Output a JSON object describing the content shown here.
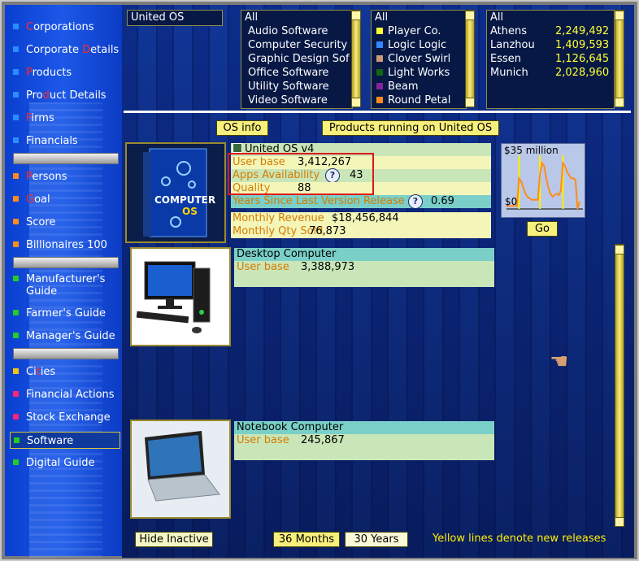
{
  "sidebar": {
    "items": [
      {
        "first": "C",
        "rest": "orporations",
        "color": "#2a8cff"
      },
      {
        "first": "Corporate ",
        "red": "D",
        "rest": "etails",
        "color": "#2a8cff"
      },
      {
        "first": "P",
        "rest": "roducts",
        "color": "#2a8cff"
      },
      {
        "first": "Pro",
        "red": "d",
        "rest": "uct Details",
        "color": "#2a8cff"
      },
      {
        "first": "F",
        "rest": "irms",
        "color": "#2a8cff"
      },
      {
        "first": "Financials",
        "rest": "",
        "color": "#2a8cff"
      },
      {
        "first": "P",
        "rest": "ersons",
        "color": "#ff8c1a"
      },
      {
        "first": "G",
        "rest": "oal",
        "color": "#ff8c1a"
      },
      {
        "first": "Score",
        "rest": "",
        "color": "#ff8c1a"
      },
      {
        "first": "Billionaires 100",
        "rest": "",
        "color": "#ff8c1a"
      },
      {
        "first": "Manufacturer's Guide",
        "rest": "",
        "color": "#22cc22"
      },
      {
        "first": "Farmer's Guide",
        "rest": "",
        "color": "#22cc22"
      },
      {
        "first": "Manager's Guide",
        "rest": "",
        "color": "#22cc22"
      },
      {
        "first": "Ci",
        "red": "t",
        "rest": "ies",
        "color": "#f2c40f"
      },
      {
        "first": "Financial Actions",
        "rest": "",
        "color": "#ff2277"
      },
      {
        "first": "Stock Exchange",
        "rest": "",
        "color": "#ff2277"
      },
      {
        "first": "Software",
        "rest": "",
        "color": "#22cc22"
      },
      {
        "first": "Digital Guide",
        "rest": "",
        "color": "#22cc22"
      }
    ]
  },
  "filters": {
    "os_selected": "United OS",
    "categories": [
      "All",
      "Audio Software",
      "Computer Security",
      "Graphic Design Sof",
      "Office Software",
      "Utility Software",
      "Video Software"
    ],
    "companies": [
      {
        "name": "All",
        "color": ""
      },
      {
        "name": "Player Co.",
        "color": "#ffff33"
      },
      {
        "name": "Logic Logic",
        "color": "#3388ff"
      },
      {
        "name": "Clover Swirl",
        "color": "#c89a78"
      },
      {
        "name": "Light Works",
        "color": "#116611"
      },
      {
        "name": "Beam",
        "color": "#882299"
      },
      {
        "name": "Round Petal",
        "color": "#ff8c1a"
      }
    ],
    "cities": [
      {
        "name": "All",
        "value": ""
      },
      {
        "name": "Athens",
        "value": "2,249,492"
      },
      {
        "name": "Lanzhou",
        "value": "1,409,593"
      },
      {
        "name": "Essen",
        "value": "1,126,645"
      },
      {
        "name": "Munich",
        "value": "2,028,960"
      }
    ]
  },
  "buttons": {
    "os_info": "OS info",
    "products_running": "Products running on United OS",
    "go": "Go",
    "hide_inactive": "Hide Inactive",
    "months36": "36 Months",
    "years30": "30 Years"
  },
  "os": {
    "name": "United OS v4",
    "user_base_label": "User base",
    "user_base": "3,412,267",
    "apps_label": "Apps Availability",
    "apps": "43",
    "quality_label": "Quality",
    "quality": "88",
    "years_label": "Years Since Last Version Release",
    "years": "0.69",
    "revenue_label": "Monthly Revenue",
    "revenue": "$18,456,844",
    "qty_label": "Monthly Qty Sold",
    "qty": "76,873",
    "box_title": "COMPUTER",
    "box_sub": "OS"
  },
  "chart_data": {
    "type": "line",
    "title": "",
    "top_label": "$35 million",
    "bottom_label": "$0",
    "ylim": [
      0,
      35
    ],
    "x": [
      0,
      1,
      2,
      3,
      4,
      5,
      6,
      7,
      8,
      9,
      10,
      11,
      12,
      13,
      14,
      15,
      16,
      17,
      18,
      19,
      20,
      21,
      22,
      23,
      24,
      25,
      26,
      27,
      28,
      29,
      30,
      31,
      32,
      33,
      34,
      35
    ],
    "series": [
      {
        "values": [
          2,
          2,
          2,
          2,
          2,
          2,
          20,
          18,
          14,
          10,
          8,
          7,
          6,
          6,
          6,
          6,
          22,
          30,
          28,
          20,
          14,
          10,
          8,
          9,
          10,
          9,
          12,
          30,
          28,
          24,
          22,
          20,
          20,
          19,
          0,
          5
        ]
      }
    ],
    "release_lines_x": [
      6,
      16,
      27
    ],
    "line_color": "#ff8c1a",
    "release_color": "#ffee00"
  },
  "devices": [
    {
      "name": "Desktop Computer",
      "label": "User base",
      "value": "3,388,973"
    },
    {
      "name": "Notebook Computer",
      "label": "User base",
      "value": "245,867"
    }
  ],
  "footer_note": "Yellow lines denote new releases"
}
